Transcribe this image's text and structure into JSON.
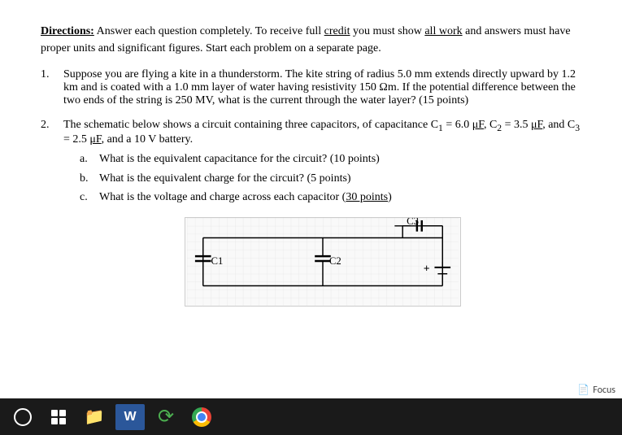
{
  "directions": {
    "label": "Directions:",
    "text": " Answer each question completely.  To receive full ",
    "credit": "credit",
    "text2": " you must show ",
    "all_work": "all work",
    "text3": " and answers must have proper units and significant figures.  Start each problem on a separate page."
  },
  "problems": [
    {
      "number": "1.",
      "text": "Suppose you are flying a kite in a thunderstorm.  The kite string of radius 5.0 mm extends directly upward by 1.2 km and is coated with a 1.0 mm layer of water having resistivity 150 Ωm.  If the potential difference between the two ends of the string is 250 MV, what is the current through the water layer?  (15 points)"
    },
    {
      "number": "2.",
      "intro": "The schematic below shows a circuit containing three capacitors, of capacitance C",
      "sub1": "1",
      "intro2": " = 6.0 μF, C",
      "sub2": "2",
      "intro3": " = 3.5 μF, and C",
      "sub3": "3",
      "intro4": " = 2.5 μF, and a 10 V battery.",
      "sub_questions": [
        {
          "label": "a.",
          "text": "What is the equivalent capacitance for the circuit? (10 points)"
        },
        {
          "label": "b.",
          "text": "What is the equivalent charge for the circuit? (5 points)"
        },
        {
          "label": "c.",
          "text": "What is the voltage and charge across each capacitor (",
          "underline": "30 points",
          "text2": ")"
        }
      ]
    }
  ],
  "circuit": {
    "labels": {
      "c1": "C1",
      "c2": "C2",
      "c3": "C3"
    }
  },
  "focus": {
    "icon": "📄",
    "label": "Focus"
  },
  "taskbar": {
    "items": [
      {
        "name": "start-button",
        "label": "⊙"
      },
      {
        "name": "apps-button",
        "label": "apps"
      },
      {
        "name": "file-explorer",
        "label": "📁"
      },
      {
        "name": "word-button",
        "label": "W"
      },
      {
        "name": "refresh-button",
        "label": "↺"
      },
      {
        "name": "chrome-button",
        "label": "chrome"
      }
    ]
  }
}
